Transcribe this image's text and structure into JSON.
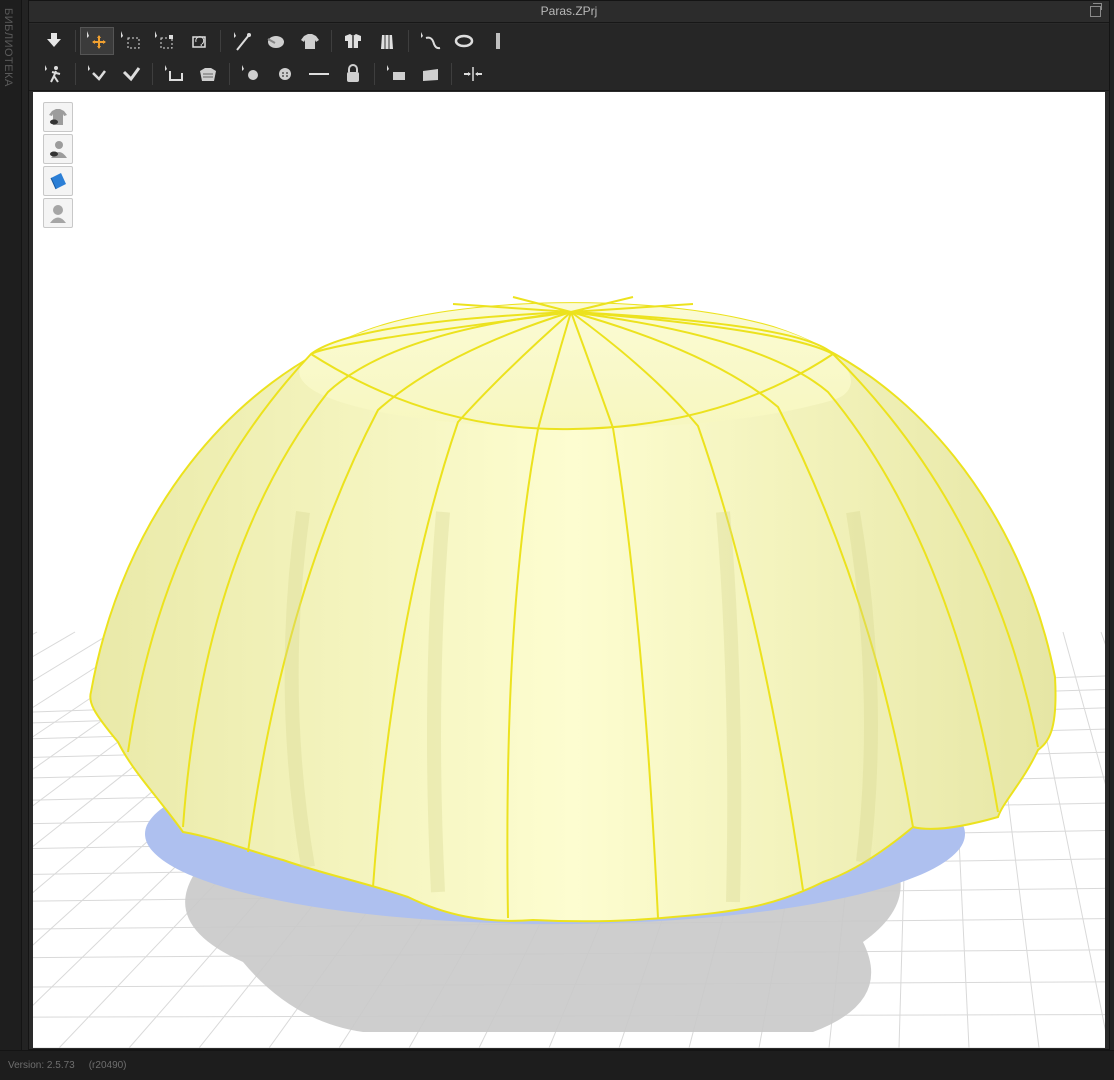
{
  "window": {
    "title": "Paras.ZPrj"
  },
  "sidebar": {
    "label": "БИБЛИОТЕКА"
  },
  "toolbar_row1": [
    {
      "name": "simulation-icon"
    },
    {
      "name": "select-move-icon",
      "active": true
    },
    {
      "name": "select-mesh-icon"
    },
    {
      "name": "transform-pattern-icon"
    },
    {
      "name": "fold-arrangement-icon"
    },
    {
      "name": "edit-avatar-pose-icon"
    },
    {
      "name": "tack-icon"
    },
    {
      "name": "garment-shirt-icon"
    },
    {
      "name": "arrangement-icon"
    },
    {
      "name": "fitting-suit-icon"
    },
    {
      "name": "sewing-line-icon"
    },
    {
      "name": "elastic-loop-icon"
    },
    {
      "name": "measure-ruler-icon"
    }
  ],
  "toolbar_row2": [
    {
      "name": "avatar-pose-icon"
    },
    {
      "name": "edit-texture-icon"
    },
    {
      "name": "brush-icon"
    },
    {
      "name": "puckering-icon"
    },
    {
      "name": "fabric-pattern-icon"
    },
    {
      "name": "button-add-icon"
    },
    {
      "name": "button-icon"
    },
    {
      "name": "topstitch-icon"
    },
    {
      "name": "zipper-lock-icon"
    },
    {
      "name": "trim-flat-icon"
    },
    {
      "name": "trim-plane-icon"
    },
    {
      "name": "align-points-icon"
    }
  ],
  "viewport_tools": [
    {
      "name": "show-garment-icon"
    },
    {
      "name": "show-avatar-icon"
    },
    {
      "name": "fabric-texture-icon"
    },
    {
      "name": "avatar-silhouette-icon"
    }
  ],
  "colors": {
    "cloth": "#fdfcc6",
    "seam": "#f2e21c",
    "base": "#aec0ef",
    "shadow": "#c9c9c9",
    "grid": "#d9d9d9"
  },
  "status": {
    "version": "Version: 2.5.73",
    "build": "(r20490)"
  }
}
